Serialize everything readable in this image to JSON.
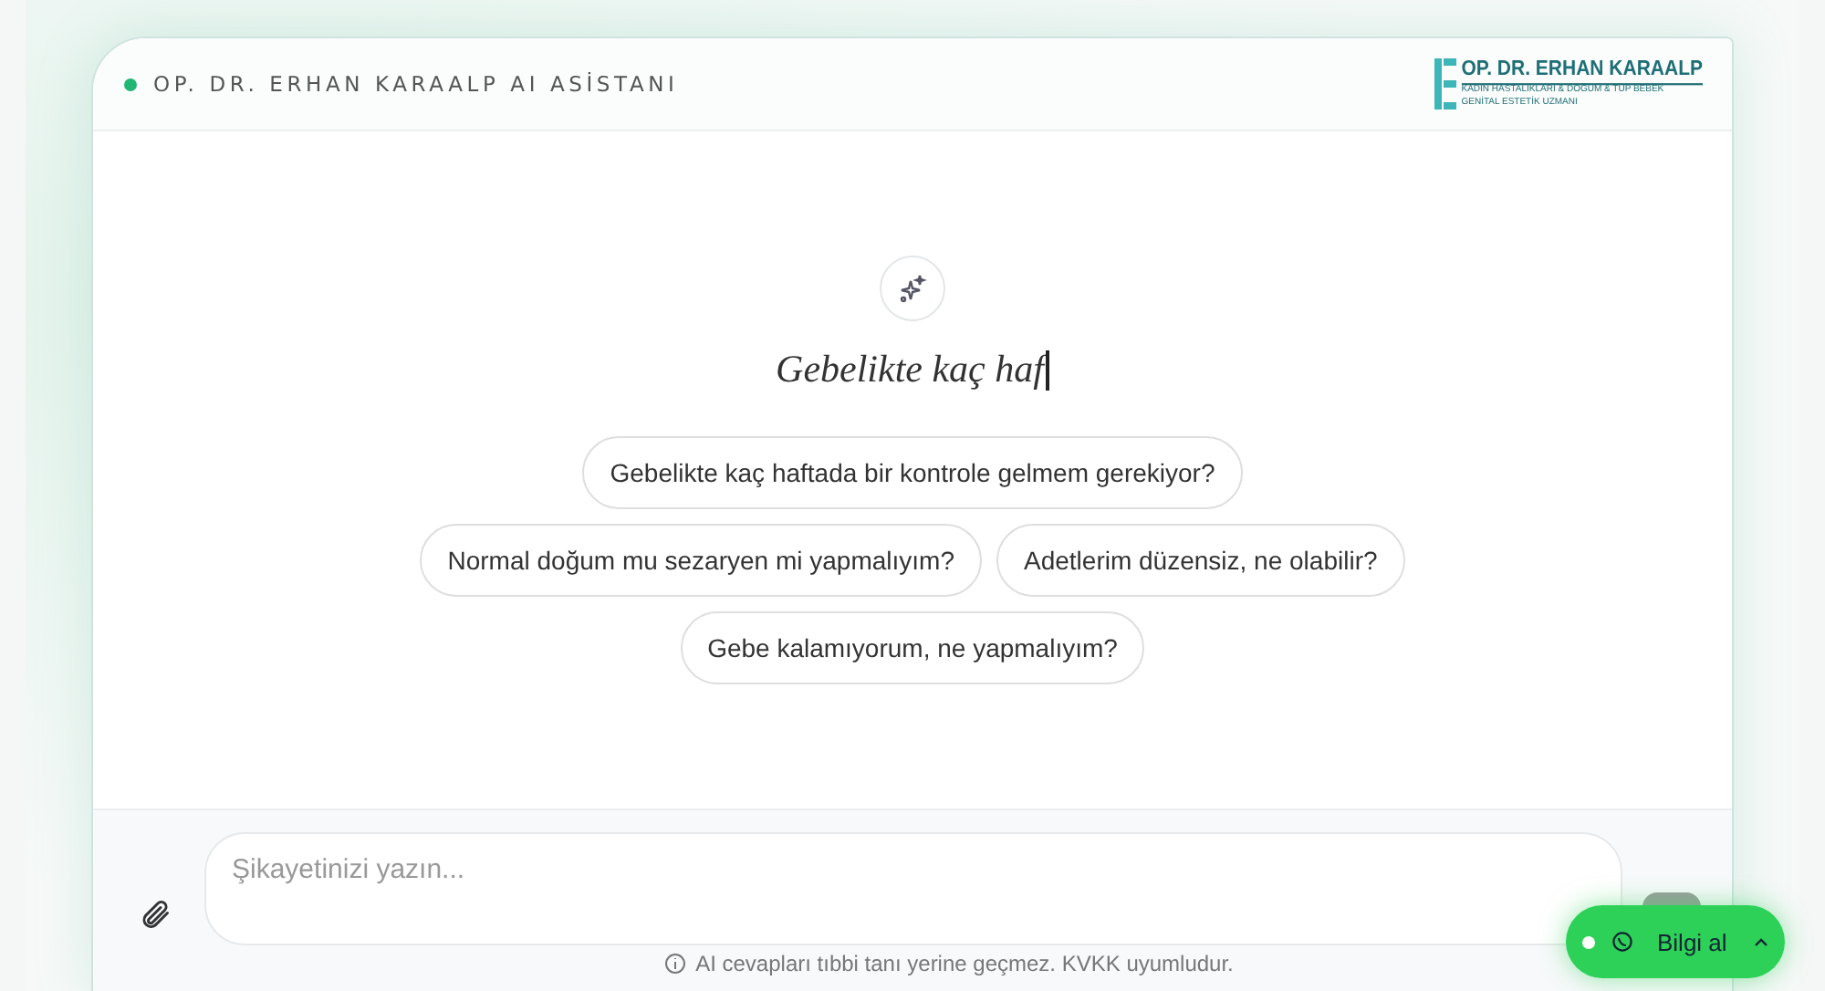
{
  "header": {
    "title": "OP. DR. ERHAN KARAALP AI ASİSTANI",
    "online": true,
    "logo": {
      "name": "OP. DR. ERHAN KARAALP",
      "line_1": "KADIN HASTALIKLARI & DOĞUM & TÜP BEBEK",
      "line_2": "GENİTAL ESTETİK UZMANI"
    }
  },
  "heading": "Gebelikte kaç haf",
  "suggestions": [
    "Gebelikte kaç haftada bir kontrole gelmem gerekiyor?",
    "Normal doğum mu sezaryen mi yapmalıyım?",
    "Adetlerim düzensiz, ne olabilir?",
    "Gebe kalamıyorum, ne yapmalıyım?"
  ],
  "composer": {
    "placeholder": "Şikayetinizi yazın..."
  },
  "disclaimer": "AI cevapları tıbbi tanı yerine geçmez. KVKK uyumludur.",
  "contact": {
    "label": "Bilgi al",
    "online": true
  }
}
